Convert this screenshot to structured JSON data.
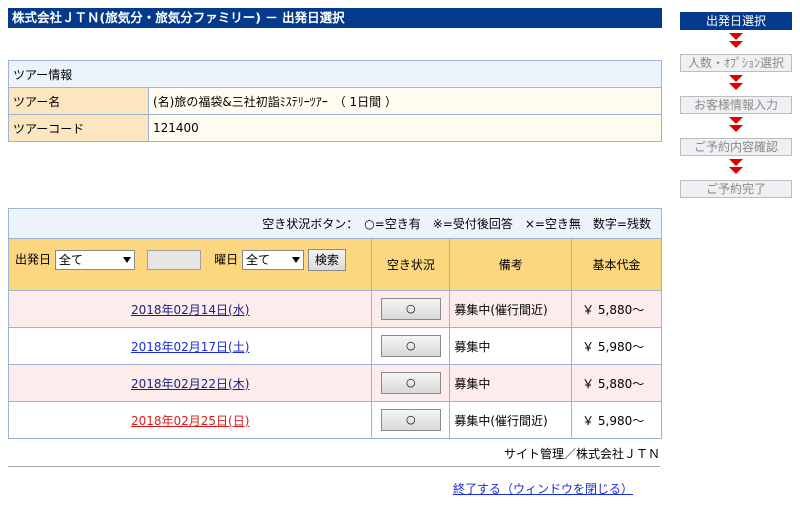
{
  "page_title": "株式会社ＪＴＮ(旅気分・旅気分ファミリー) － 出発日選択",
  "steps": [
    {
      "label": "出発日選択",
      "active": true
    },
    {
      "label": "人数・ｵﾌﾟｼｮﾝ選択",
      "active": false
    },
    {
      "label": "お客様情報入力",
      "active": false
    },
    {
      "label": "ご予約内容確認",
      "active": false
    },
    {
      "label": "ご予約完了",
      "active": false
    }
  ],
  "tour_info": {
    "header": "ツアー情報",
    "name_label": "ツアー名",
    "name_value": "(名)旅の福袋&三社初詣ﾐｽﾃﾘｰﾂｱｰ　（ 1日間 ）",
    "code_label": "ツアーコード",
    "code_value": "121400"
  },
  "legend": "空き状況ボタン：　○=空き有　※=受付後回答　×=空き無　数字=残数",
  "filter": {
    "departure_label": "出発日",
    "departure_value": "全て",
    "date_input_value": "",
    "weekday_label": "曜日",
    "weekday_value": "全て",
    "search_label": "検索"
  },
  "columns": {
    "availability": "空き状況",
    "remarks": "備考",
    "base_price": "基本代金"
  },
  "colors": {
    "title_bar": "#043a8c",
    "header_orange": "#fcd77f",
    "date_default": "#1a237e",
    "date_saturday": "#1a2ad6",
    "date_sunday": "#e01b1b",
    "step_arrow": "#e00000"
  },
  "rows": [
    {
      "date": "2018年02月14日(水)",
      "availability": "○",
      "remarks": "募集中(催行間近)",
      "price": "￥ 5,880～",
      "day_type": "weekday",
      "shade": "pink"
    },
    {
      "date": "2018年02月17日(土)",
      "availability": "○",
      "remarks": "募集中",
      "price": "￥ 5,980～",
      "day_type": "saturday",
      "shade": "white"
    },
    {
      "date": "2018年02月22日(木)",
      "availability": "○",
      "remarks": "募集中",
      "price": "￥ 5,880～",
      "day_type": "weekday",
      "shade": "pink"
    },
    {
      "date": "2018年02月25日(日)",
      "availability": "○",
      "remarks": "募集中(催行間近)",
      "price": "￥ 5,980～",
      "day_type": "sunday",
      "shade": "white"
    }
  ],
  "footer": {
    "admin": "サイト管理／株式会社ＪＴＮ",
    "close_link": "終了する（ウィンドウを閉じる）"
  }
}
